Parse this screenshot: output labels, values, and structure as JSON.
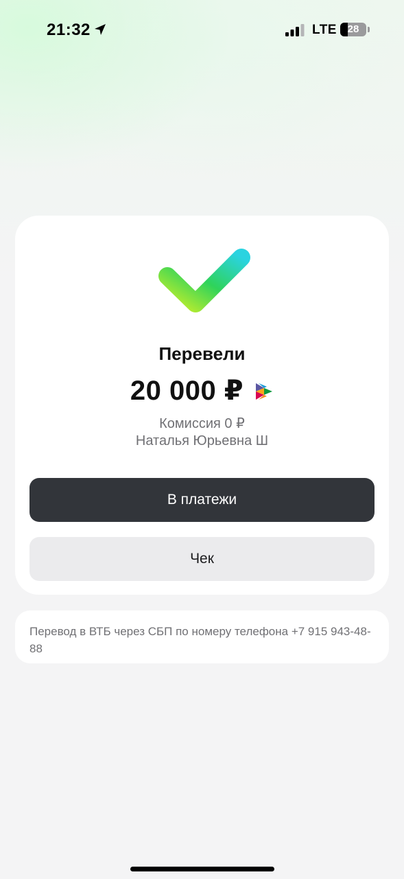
{
  "status_bar": {
    "time": "21:32",
    "network": "LTE",
    "battery_level": "28",
    "battery_fraction": 0.28
  },
  "result": {
    "title": "Перевели",
    "amount": "20 000 ₽",
    "commission": "Комиссия 0 ₽",
    "recipient": "Наталья Юрьевна Ш"
  },
  "actions": {
    "to_payments": "В платежи",
    "receipt": "Чек"
  },
  "details": {
    "text": "Перевод в ВТБ через СБП по номеру телефона +7 915 943-48-88"
  },
  "colors": {
    "check_gradient_start": "#c6ef2a",
    "check_gradient_end": "#2ad3e0",
    "primary_button": "#32353a",
    "secondary_button": "#ebebed"
  },
  "icons": {
    "location": "location-arrow-icon",
    "signal": "signal-bars-icon",
    "success": "checkmark-icon",
    "payment_system": "sbp-logo-icon"
  }
}
